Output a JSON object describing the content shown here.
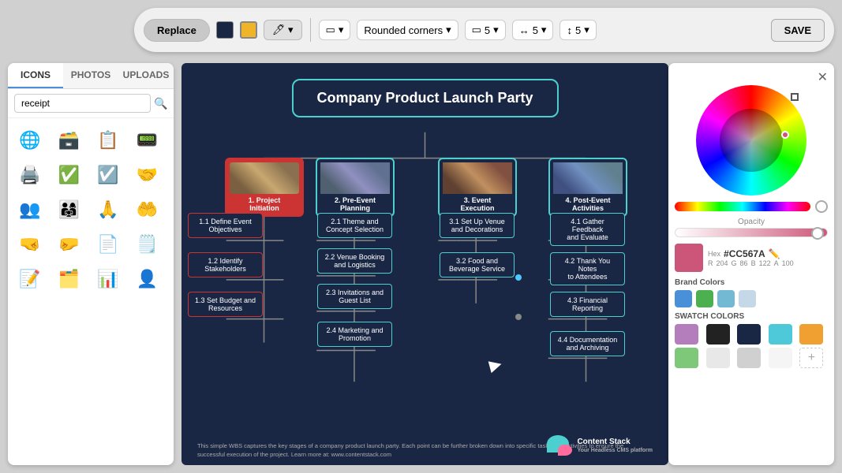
{
  "toolbar": {
    "replace_label": "Replace",
    "rounded_corners_label": "Rounded corners",
    "border_size_label": "5",
    "h_spacing_label": "5",
    "v_spacing_label": "5",
    "save_label": "SAVE"
  },
  "left_panel": {
    "tabs": [
      {
        "id": "icons",
        "label": "ICONS"
      },
      {
        "id": "photos",
        "label": "PHOTOS"
      },
      {
        "id": "uploads",
        "label": "UPLOADS"
      }
    ],
    "search_placeholder": "receipt",
    "icons": [
      "🌐",
      "🗃️",
      "📋",
      "📟",
      "🖨️",
      "✅",
      "✅",
      "🤝",
      "👥",
      "👨‍👩‍👧",
      "🤗",
      "🤲",
      "🤝",
      "🤜",
      "📄",
      "📋",
      "📝",
      "🗂️",
      "📊",
      "👤"
    ]
  },
  "canvas": {
    "title": "Company Product Launch Party",
    "l1_boxes": [
      {
        "id": "l1-1",
        "label": "1. Project\nInitiation",
        "color": "#cc3333"
      },
      {
        "id": "l1-2",
        "label": "2. Pre-Event\nPlanning",
        "color": "#1a2744"
      },
      {
        "id": "l1-3",
        "label": "3. Event\nExecution",
        "color": "#1a2744"
      },
      {
        "id": "l1-4",
        "label": "4. Post-Event\nActivities",
        "color": "#1a2744"
      }
    ],
    "l2_boxes": [
      {
        "id": "1.1",
        "label": "1.1 Define Event\nObjectives",
        "color": "#cc3333"
      },
      {
        "id": "1.2",
        "label": "1.2 Identify\nStakeholders",
        "color": "#cc3333"
      },
      {
        "id": "1.3",
        "label": "1.3 Set Budget and\nResources",
        "color": "#cc3333"
      },
      {
        "id": "2.1",
        "label": "2.1 Theme and\nConcept Selection",
        "color": "#4dcfcf"
      },
      {
        "id": "2.2",
        "label": "2.2 Venue Booking\nand Logistics",
        "color": "#4dcfcf"
      },
      {
        "id": "2.3",
        "label": "2.3 Invitations and\nGuest List",
        "color": "#4dcfcf"
      },
      {
        "id": "2.4",
        "label": "2.4 Marketing and\nPromotion",
        "color": "#4dcfcf"
      },
      {
        "id": "3.1",
        "label": "3.1 Set Up Venue\nand Decorations",
        "color": "#4dcfcf"
      },
      {
        "id": "3.2",
        "label": "3.2 Food and\nBeverage Service",
        "color": "#4dcfcf"
      },
      {
        "id": "4.1",
        "label": "4.1 Gather Feedback\nand Evaluate",
        "color": "#4dcfcf"
      },
      {
        "id": "4.2",
        "label": "4.2 Thank You Notes\nto Attendees",
        "color": "#4dcfcf"
      },
      {
        "id": "4.3",
        "label": "4.3 Financial\nReporting",
        "color": "#4dcfcf"
      },
      {
        "id": "4.4",
        "label": "4.4 Documentation\nand Archiving",
        "color": "#4dcfcf"
      }
    ],
    "footer_text": "This simple WBS captures the key stages of a company product launch party. Each point can be further broken down into specific tasks and activities to ensure the successful execution of the project. Learn more at: www.contentstack.com",
    "logo_name": "Content Stack",
    "logo_tagline": "Your Headless CMS platform"
  },
  "right_panel": {
    "opacity_label": "Opacity",
    "hex_label": "Hex",
    "hex_value": "#CC567A",
    "rgb": {
      "r": 204,
      "g": 86,
      "b": 122,
      "a": 100
    },
    "brand_colors_label": "Brand Colors",
    "brand_colors": [
      "#4a90d9",
      "#4caf50",
      "#74b9d4",
      "#c5d8e8"
    ],
    "swatch_label": "SWATCH COLORS",
    "swatch_colors": [
      "#b47ebd",
      "#222222",
      "#1a2744",
      "#4dc9d9",
      "#f0a030",
      "#7ec87a",
      "#fff",
      "#d9d9d9",
      "#fff",
      "#fff"
    ]
  }
}
